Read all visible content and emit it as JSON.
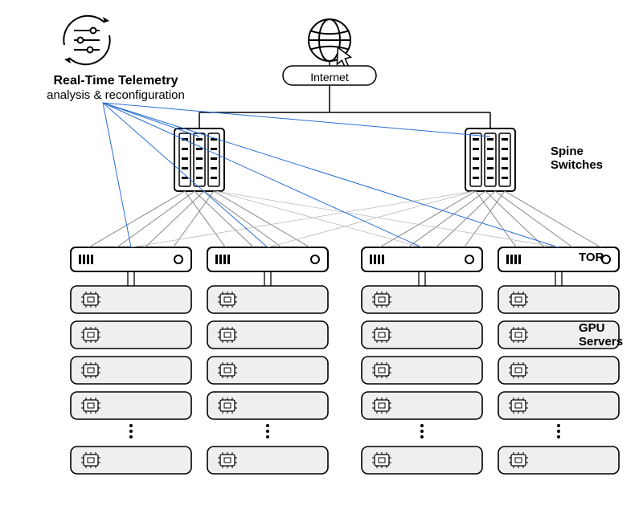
{
  "telemetry": {
    "title": "Real-Time Telemetry",
    "subtitle": "analysis & reconfiguration"
  },
  "internet": {
    "label": "Internet"
  },
  "labels": {
    "spine": "Spine\nSwitches",
    "tor": "TOR",
    "gpu": "GPU\nServers"
  },
  "topology": {
    "spine_switches": 2,
    "tor_per_spine": 2,
    "gpu_rows_shown_per_tor": 5,
    "gpu_rows_continuation": true
  },
  "colors": {
    "telemetry_line": "#2b6fd6",
    "stroke": "#000000",
    "server_fill": "#efefef"
  }
}
